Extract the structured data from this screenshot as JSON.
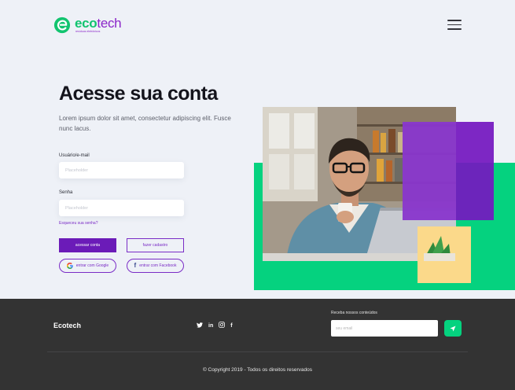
{
  "brand": {
    "name_part1": "eco",
    "name_part2": "tech",
    "tagline": "resíduos eletrônicos",
    "green": "#12c46f",
    "purple": "#8b26c9"
  },
  "header": {
    "menu_icon": "hamburger-icon"
  },
  "hero": {
    "title": "Acesse sua conta",
    "description": "Lorem ipsum dolor sit amet, consectetur adipiscing elit. Fusce nunc lacus."
  },
  "form": {
    "user_label": "Usuário/e-mail",
    "user_placeholder": "Placeholder",
    "password_label": "Senha",
    "password_placeholder": "Placeholder",
    "forgot_link": "Esqueceu sua senha?",
    "login_button": "acessar conta",
    "signup_button": "fazer cadastro",
    "google_button": "entrar com Google",
    "facebook_button": "entrar com Facebook"
  },
  "illustration": {
    "photo_icon": "man-with-laptop-photo",
    "colors": {
      "green": "#05d27f",
      "purple": "#7418c0",
      "yellow": "#fbd98a"
    }
  },
  "footer": {
    "brand": "Ecotech",
    "social": {
      "twitter": "𝕏",
      "linkedin": "in",
      "instagram": "◎",
      "facebook": "f"
    },
    "newsletter_label": "Receba nossos conteúdos",
    "email_placeholder": "seu email",
    "copyright": "© Copyright 2019 - Todos os direitos reservados",
    "background": "#333333"
  }
}
